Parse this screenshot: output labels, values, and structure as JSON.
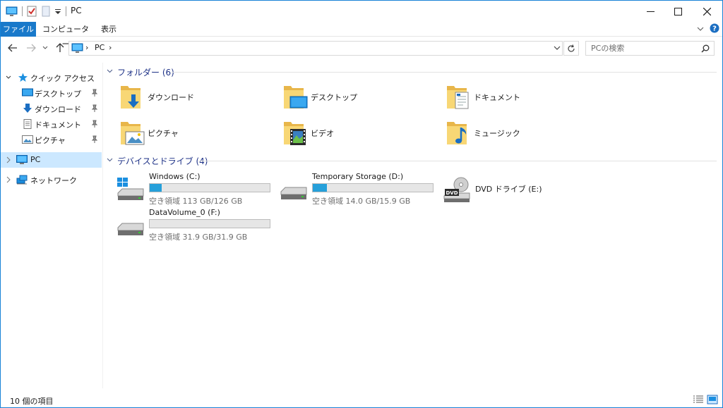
{
  "window": {
    "title": "PC"
  },
  "ribbon": {
    "tabs": [
      "ファイル",
      "コンピューター",
      "表示"
    ],
    "help_icon": "help-icon"
  },
  "address": {
    "path": [
      "PC"
    ],
    "search_placeholder": "PCの検索"
  },
  "nav": {
    "quick_access": "クイック アクセス",
    "quick_items": [
      "デスクトップ",
      "ダウンロード",
      "ドキュメント",
      "ピクチャ"
    ],
    "pc": "PC",
    "network": "ネットワーク"
  },
  "folders": {
    "header": "フォルダー (6)",
    "items": [
      "ダウンロード",
      "デスクトップ",
      "ドキュメント",
      "ピクチャ",
      "ビデオ",
      "ミュージック"
    ]
  },
  "devices": {
    "header": "デバイスとドライブ (4)",
    "drives": [
      {
        "name": "Windows (C:)",
        "free": "空き領域 113 GB/126 GB",
        "used_fraction": 0.1
      },
      {
        "name": "Temporary Storage (D:)",
        "free": "空き領域 14.0 GB/15.9 GB",
        "used_fraction": 0.12
      },
      {
        "name": "DVD ドライブ (E:)"
      },
      {
        "name": "DataVolume_0 (F:)",
        "free": "空き領域 31.9 GB/31.9 GB",
        "used_fraction": 0.0
      }
    ]
  },
  "status": {
    "count": "10 個の項目"
  },
  "colors": {
    "accent": "#1979ca",
    "selection": "#cce8ff",
    "bar_fill": "#26a0da",
    "group_header": "#1e3287"
  }
}
